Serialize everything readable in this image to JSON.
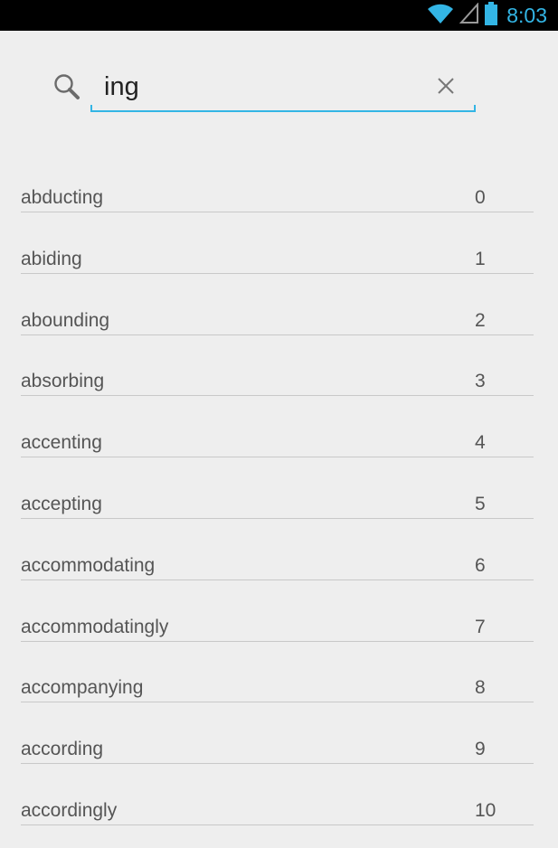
{
  "colors": {
    "accent": "#33b5e5",
    "background": "#eeeeee",
    "status_bar": "#000000"
  },
  "status_bar": {
    "time": "8:03",
    "icons": [
      "wifi-icon",
      "signal-icon",
      "battery-icon"
    ]
  },
  "search": {
    "icon": "search-icon",
    "query": "ing",
    "clear_icon": "close-icon"
  },
  "results": [
    {
      "word": "abducting",
      "count": "0"
    },
    {
      "word": "abiding",
      "count": "1"
    },
    {
      "word": "abounding",
      "count": "2"
    },
    {
      "word": "absorbing",
      "count": "3"
    },
    {
      "word": "accenting",
      "count": "4"
    },
    {
      "word": "accepting",
      "count": "5"
    },
    {
      "word": "accommodating",
      "count": "6"
    },
    {
      "word": "accommodatingly",
      "count": "7"
    },
    {
      "word": "accompanying",
      "count": "8"
    },
    {
      "word": "according",
      "count": "9"
    },
    {
      "word": "accordingly",
      "count": "10"
    }
  ]
}
